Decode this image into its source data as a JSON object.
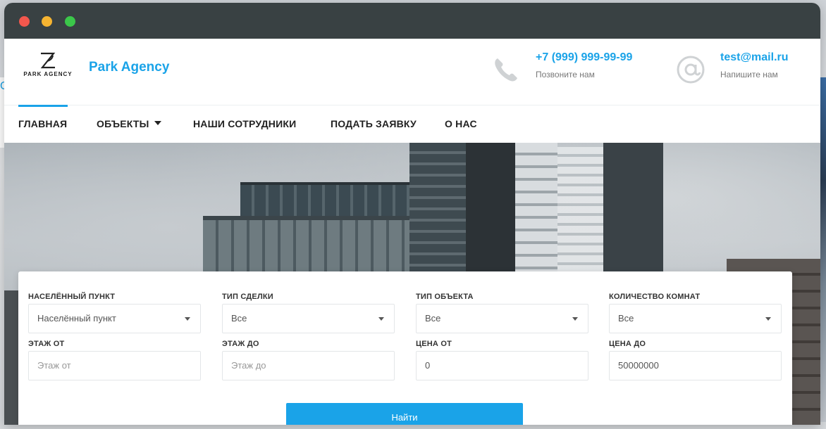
{
  "window": {
    "controls": [
      "close",
      "minimize",
      "maximize"
    ]
  },
  "header": {
    "logo_caption": "PARK AGENCY",
    "brand": "Park Agency",
    "phone": {
      "icon": "phone-icon",
      "number": "+7 (999) 999-99-99",
      "caption": "Позвоните нам"
    },
    "email": {
      "icon": "at-icon",
      "address": "test@mail.ru",
      "caption": "Напишите нам"
    }
  },
  "nav": {
    "items": [
      {
        "label": "ГЛАВНАЯ",
        "active": true
      },
      {
        "label": "ОБЪЕКТЫ",
        "dropdown": true
      },
      {
        "label": "НАШИ СОТРУДНИКИ"
      },
      {
        "label": "ПОДАТЬ ЗАЯВКУ"
      },
      {
        "label": "О НАС"
      }
    ]
  },
  "search": {
    "locality": {
      "label": "НАСЕЛЁННЫЙ ПУНКТ",
      "value": "Населённый пункт"
    },
    "deal_type": {
      "label": "ТИП СДЕЛКИ",
      "value": "Все"
    },
    "object_type": {
      "label": "ТИП ОБЪЕКТА",
      "value": "Все"
    },
    "rooms": {
      "label": "КОЛИЧЕСТВО КОМНАТ",
      "value": "Все"
    },
    "floor_from": {
      "label": "ЭТАЖ ОТ",
      "placeholder": "Этаж от"
    },
    "floor_to": {
      "label": "ЭТАЖ ДО",
      "placeholder": "Этаж до"
    },
    "price_from": {
      "label": "ЦЕНА ОТ",
      "value": "0"
    },
    "price_to": {
      "label": "ЦЕНА ДО",
      "value": "50000000"
    },
    "submit_label": "Найти"
  },
  "colors": {
    "accent": "#1aa3e8",
    "titlebar": "#394143",
    "text": "#222222"
  }
}
